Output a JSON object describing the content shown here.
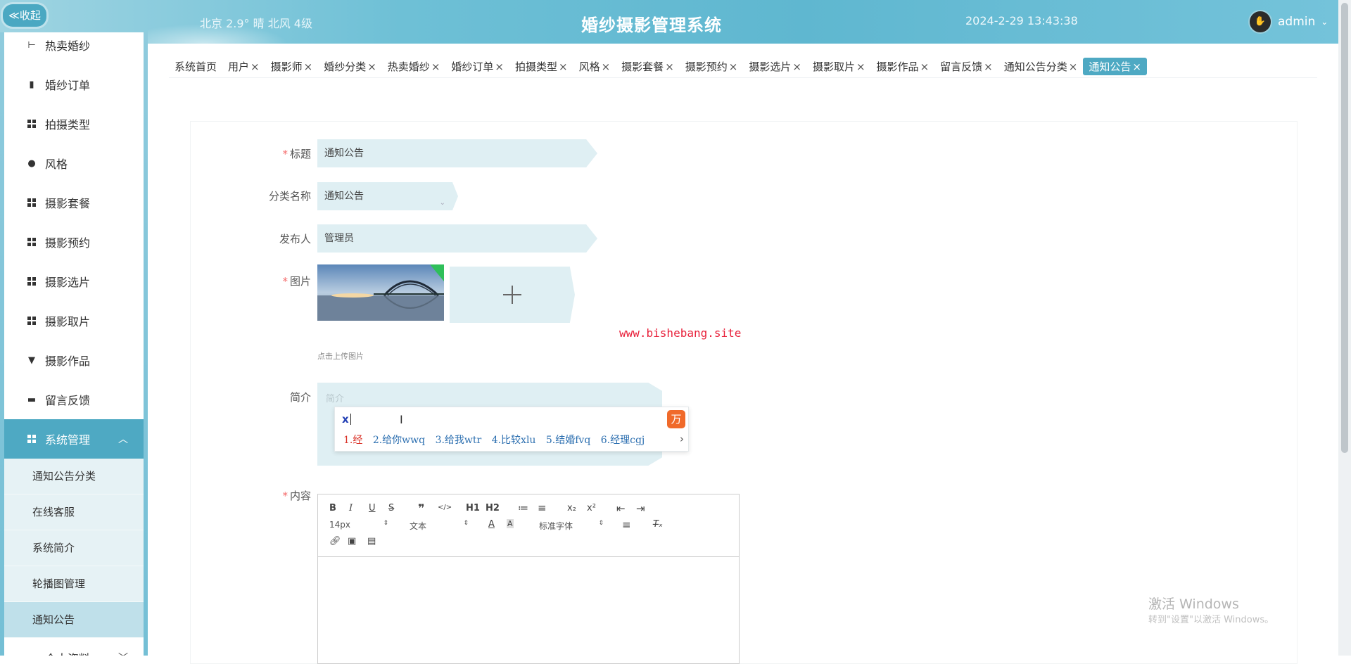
{
  "header": {
    "collapse_label": "≪收起",
    "weather": "北京 2.9° 晴 北风 4级",
    "title": "婚纱摄影管理系统",
    "clock": "2024-2-29 13:43:38",
    "user": "admin"
  },
  "sidebar": {
    "items": [
      {
        "label": "热卖婚纱",
        "icon": "shirt-icon"
      },
      {
        "label": "婚纱订单",
        "icon": "book-icon"
      },
      {
        "label": "拍摄类型",
        "icon": "grid-icon"
      },
      {
        "label": "风格",
        "icon": "person-icon"
      },
      {
        "label": "摄影套餐",
        "icon": "grid-icon"
      },
      {
        "label": "摄影预约",
        "icon": "grid-icon"
      },
      {
        "label": "摄影选片",
        "icon": "grid-icon"
      },
      {
        "label": "摄影取片",
        "icon": "grid-icon"
      },
      {
        "label": "摄影作品",
        "icon": "brush-icon"
      },
      {
        "label": "留言反馈",
        "icon": "briefcase-icon"
      }
    ],
    "group": {
      "label": "系统管理",
      "icon": "grid-icon"
    },
    "sub_items": [
      {
        "label": "通知公告分类"
      },
      {
        "label": "在线客服"
      },
      {
        "label": "系统简介"
      },
      {
        "label": "轮播图管理"
      },
      {
        "label": "通知公告"
      }
    ],
    "profile": {
      "label": "个人资料",
      "icon": "card-icon"
    }
  },
  "tabs": [
    {
      "label": "系统首页",
      "closable": false
    },
    {
      "label": "用户",
      "closable": true
    },
    {
      "label": "摄影师",
      "closable": true
    },
    {
      "label": "婚纱分类",
      "closable": true
    },
    {
      "label": "热卖婚纱",
      "closable": true
    },
    {
      "label": "婚纱订单",
      "closable": true
    },
    {
      "label": "拍摄类型",
      "closable": true
    },
    {
      "label": "风格",
      "closable": true
    },
    {
      "label": "摄影套餐",
      "closable": true
    },
    {
      "label": "摄影预约",
      "closable": true
    },
    {
      "label": "摄影选片",
      "closable": true
    },
    {
      "label": "摄影取片",
      "closable": true
    },
    {
      "label": "摄影作品",
      "closable": true
    },
    {
      "label": "留言反馈",
      "closable": true
    },
    {
      "label": "通知公告分类",
      "closable": true
    },
    {
      "label": "通知公告",
      "closable": true,
      "active": true
    }
  ],
  "form": {
    "title_label": "标题",
    "title_value": "通知公告",
    "category_label": "分类名称",
    "category_value": "通知公告",
    "publisher_label": "发布人",
    "publisher_value": "管理员",
    "image_label": "图片",
    "upload_hint": "点击上传图片",
    "summary_label": "简介",
    "summary_placeholder": "简介",
    "content_label": "内容",
    "watermark_url": "www.bishebang.site"
  },
  "ime": {
    "typed": "x",
    "logo": "万",
    "candidates": [
      "1.经",
      "2.给你wwq",
      "3.给我wtr",
      "4.比较xlu",
      "5.结婚fvq",
      "6.经理cgj"
    ]
  },
  "editor": {
    "font_size": "14px",
    "paragraph": "文本",
    "font_family": "标准字体",
    "buttons": [
      "B",
      "I",
      "U",
      "S",
      "❞",
      "</>",
      "H1",
      "H2",
      "≔",
      "≡",
      "x₂",
      "x²",
      "⇤",
      "⇥"
    ]
  },
  "windows_watermark": {
    "line1": "激活 Windows",
    "line2": "转到\"设置\"以激活 Windows。"
  },
  "colors": {
    "accent": "#4ea9c3",
    "field_bg": "#dfeff3",
    "header_bg": "#6ec0d6"
  }
}
